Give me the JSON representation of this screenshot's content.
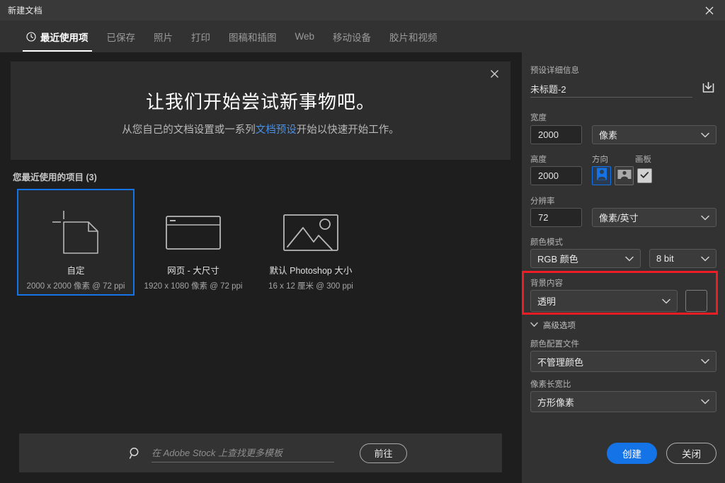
{
  "window": {
    "title": "新建文档",
    "close_icon": "close-icon"
  },
  "tabs": [
    {
      "label": "最近使用项",
      "icon": "clock-icon",
      "active": true
    },
    {
      "label": "已保存",
      "active": false
    },
    {
      "label": "照片",
      "active": false
    },
    {
      "label": "打印",
      "active": false
    },
    {
      "label": "图稿和插图",
      "active": false
    },
    {
      "label": "Web",
      "active": false
    },
    {
      "label": "移动设备",
      "active": false
    },
    {
      "label": "胶片和视频",
      "active": false
    }
  ],
  "banner": {
    "title": "让我们开始尝试新事物吧。",
    "sub_before": "从您自己的文档设置或一系列",
    "sub_link": "文档预设",
    "sub_after": "开始以快速开始工作。",
    "close_icon": "close-icon"
  },
  "recent": {
    "heading": "您最近使用的项目 (3)",
    "items": [
      {
        "icon": "custom-page-icon",
        "name": "自定",
        "spec": "2000 x 2000 像素 @ 72 ppi",
        "selected": true
      },
      {
        "icon": "browser-window-icon",
        "name": "网页 - 大尺寸",
        "spec": "1920 x 1080 像素 @ 72 ppi",
        "selected": false
      },
      {
        "icon": "photo-image-icon",
        "name": "默认 Photoshop 大小",
        "spec": "16 x 12 厘米 @ 300 ppi",
        "selected": false
      }
    ]
  },
  "stock": {
    "search_icon": "search-icon",
    "placeholder": "在 Adobe Stock 上查找更多模板",
    "value": "",
    "go_label": "前往"
  },
  "sidebar": {
    "section_label": "预设详细信息",
    "preset_name": "未标题-2",
    "save_preset_icon": "save-download-icon",
    "width": {
      "label": "宽度",
      "value": "2000",
      "unit": "像素"
    },
    "height": {
      "label": "高度",
      "value": "2000"
    },
    "orientation": {
      "label": "方向",
      "portrait_icon": "portrait-orientation-icon",
      "landscape_icon": "landscape-orientation-icon",
      "selected": "portrait"
    },
    "artboard": {
      "label": "画板",
      "checked": true,
      "check_icon": "check-icon"
    },
    "resolution": {
      "label": "分辨率",
      "value": "72",
      "unit": "像素/英寸"
    },
    "color_mode": {
      "label": "颜色模式",
      "value": "RGB 颜色",
      "depth": "8 bit"
    },
    "background": {
      "label": "背景内容",
      "value": "透明",
      "swatch_color": "#323232",
      "highlight_color": "#ee1c25"
    },
    "advanced": {
      "label": "高级选项",
      "expanded": true,
      "chevron_icon": "chevron-down-icon",
      "color_profile": {
        "label": "颜色配置文件",
        "value": "不管理颜色"
      },
      "pixel_aspect": {
        "label": "像素长宽比",
        "value": "方形像素"
      }
    },
    "actions": {
      "create_label": "创建",
      "close_label": "关闭",
      "accent_color": "#1473e6"
    }
  }
}
